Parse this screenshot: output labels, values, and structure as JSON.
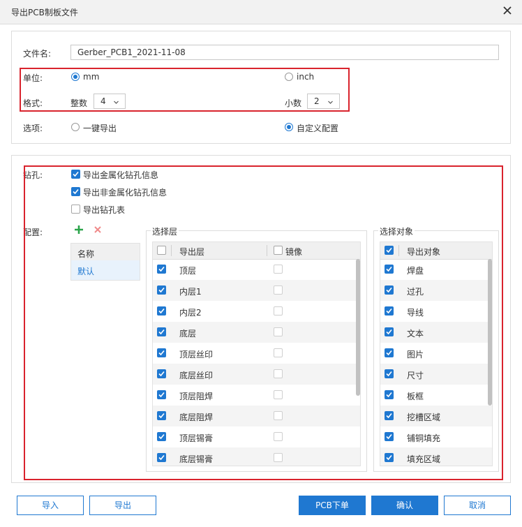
{
  "window": {
    "title": "导出PCB制板文件"
  },
  "top": {
    "filename_label": "文件名:",
    "filename_value": "Gerber_PCB1_2021-11-08",
    "unit_label": "单位:",
    "unit_mm": "mm",
    "unit_inch": "inch",
    "format_label": "格式:",
    "integer_label": "整数",
    "integer_value": "4",
    "decimal_label": "小数",
    "decimal_value": "2",
    "options_label": "选项:",
    "option_oneclick": "一键导出",
    "option_custom": "自定义配置"
  },
  "drill": {
    "label": "钻孔:",
    "items": [
      {
        "label": "导出金属化钻孔信息",
        "checked": true
      },
      {
        "label": "导出非金属化钻孔信息",
        "checked": true
      },
      {
        "label": "导出钻孔表",
        "checked": false
      }
    ]
  },
  "config": {
    "label": "配置:",
    "list_header": "名称",
    "list_items": [
      "默认"
    ]
  },
  "layers": {
    "legend": "选择层",
    "col_layer": "导出层",
    "col_mirror": "镜像",
    "rows": [
      {
        "name": "顶层",
        "checked": true
      },
      {
        "name": "内层1",
        "checked": true
      },
      {
        "name": "内层2",
        "checked": true
      },
      {
        "name": "底层",
        "checked": true
      },
      {
        "name": "顶层丝印",
        "checked": true
      },
      {
        "name": "底层丝印",
        "checked": true
      },
      {
        "name": "顶层阻焊",
        "checked": true
      },
      {
        "name": "底层阻焊",
        "checked": true
      },
      {
        "name": "顶层锡膏",
        "checked": true
      },
      {
        "name": "底层锡膏",
        "checked": true
      }
    ]
  },
  "objects": {
    "legend": "选择对象",
    "col_object": "导出对象",
    "rows": [
      {
        "name": "焊盘",
        "checked": true
      },
      {
        "name": "过孔",
        "checked": true
      },
      {
        "name": "导线",
        "checked": true
      },
      {
        "name": "文本",
        "checked": true
      },
      {
        "name": "图片",
        "checked": true
      },
      {
        "name": "尺寸",
        "checked": true
      },
      {
        "name": "板框",
        "checked": true
      },
      {
        "name": "挖槽区域",
        "checked": true
      },
      {
        "name": "铺铜填充",
        "checked": true
      },
      {
        "name": "填充区域",
        "checked": true
      }
    ]
  },
  "buttons": {
    "import": "导入",
    "export": "导出",
    "pcb_order": "PCB下单",
    "confirm": "确认",
    "cancel": "取消"
  },
  "colors": {
    "accent": "#1f78d1",
    "highlight_border": "#d9232d",
    "add": "#2aa44a",
    "delete": "#f08a8a"
  }
}
